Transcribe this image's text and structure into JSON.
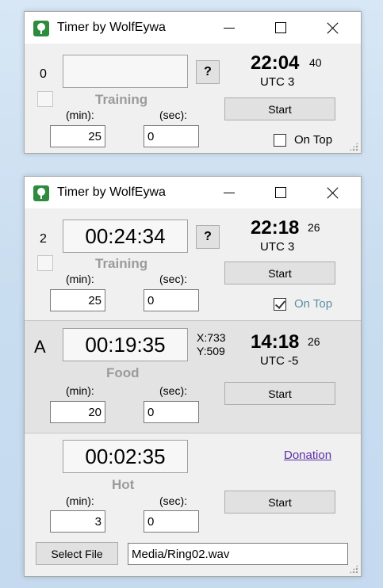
{
  "window1": {
    "title": "Timer by WolfEywa",
    "counter": "0",
    "question_label": "?",
    "training_label": "Training",
    "min_label": "(min):",
    "sec_label": "(sec):",
    "min_value": "25",
    "sec_value": "0",
    "clock_time": "22:04",
    "clock_seconds": "40",
    "utc_label": "UTC 3",
    "start_label": "Start",
    "ontop_label": "On Top",
    "ontop_checked": false
  },
  "window2": {
    "title": "Timer by WolfEywa",
    "timer1": {
      "counter": "2",
      "display": "00:24:34",
      "question_label": "?",
      "name": "Training",
      "min_label": "(min):",
      "sec_label": "(sec):",
      "min_value": "25",
      "sec_value": "0",
      "clock_time": "22:18",
      "clock_seconds": "26",
      "utc_label": "UTC 3",
      "start_label": "Start",
      "ontop_label": "On Top",
      "ontop_checked": true
    },
    "timer2": {
      "letter": "A",
      "display": "00:19:35",
      "coord_x": "X:733",
      "coord_y": "Y:509",
      "name": "Food",
      "min_label": "(min):",
      "sec_label": "(sec):",
      "min_value": "20",
      "sec_value": "0",
      "clock_time": "14:18",
      "clock_seconds": "26",
      "utc_label": "UTC -5",
      "start_label": "Start"
    },
    "timer3": {
      "display": "00:02:35",
      "name": "Hot",
      "min_label": "(min):",
      "sec_label": "(sec):",
      "min_value": "3",
      "sec_value": "0",
      "start_label": "Start",
      "donation_label": "Donation",
      "select_file_label": "Select File",
      "file_path": "Media/Ring02.wav"
    }
  }
}
